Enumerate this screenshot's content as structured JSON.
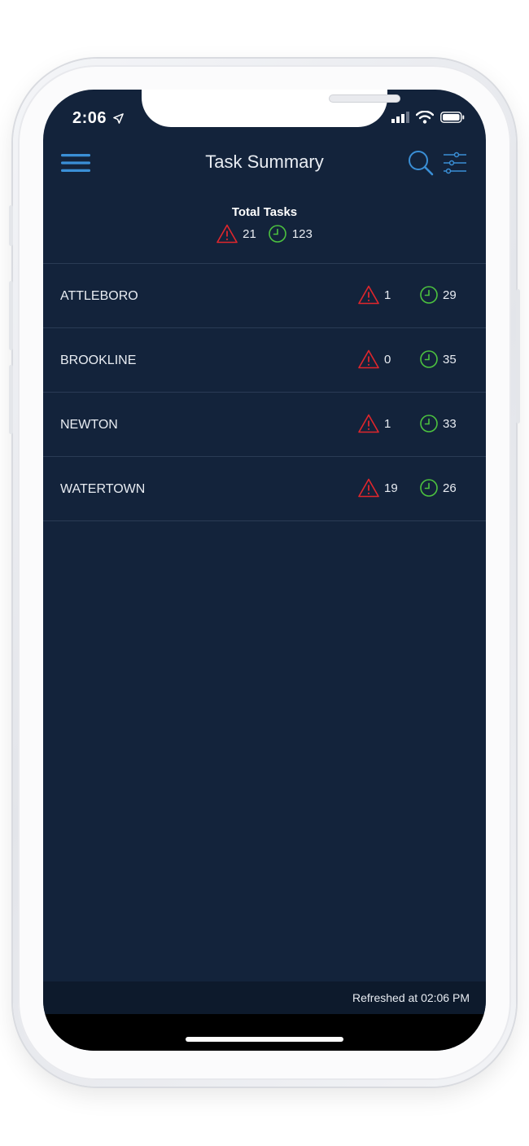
{
  "status_bar": {
    "time": "2:06"
  },
  "nav": {
    "title": "Task Summary"
  },
  "total": {
    "title": "Total Tasks",
    "warning_count": "21",
    "pending_count": "123"
  },
  "locations": [
    {
      "name": "ATTLEBORO",
      "warning": "1",
      "pending": "29"
    },
    {
      "name": "BROOKLINE",
      "warning": "0",
      "pending": "35"
    },
    {
      "name": "NEWTON",
      "warning": "1",
      "pending": "33"
    },
    {
      "name": "WATERTOWN",
      "warning": "19",
      "pending": "26"
    }
  ],
  "footer": {
    "refreshed": "Refreshed at 02:06 PM"
  },
  "colors": {
    "background": "#13233b",
    "accent": "#3a8fd6",
    "warning": "#e0262c",
    "pending": "#4cc23f"
  },
  "icons": [
    "menu-icon",
    "search-icon",
    "filter-icon",
    "warning-icon",
    "clock-icon",
    "location-arrow-icon",
    "signal-icon",
    "wifi-icon",
    "battery-icon"
  ]
}
